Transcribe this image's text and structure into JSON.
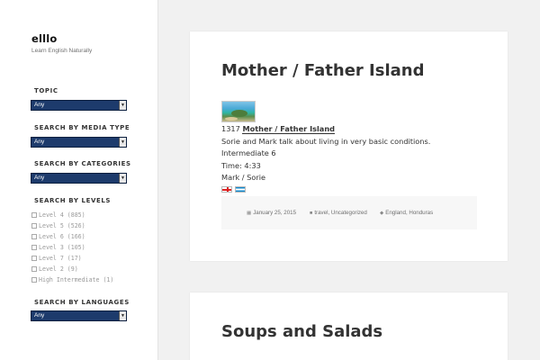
{
  "site": {
    "title": "elllo",
    "description": "Learn English Naturally"
  },
  "sidebar": {
    "topic": {
      "title": "TOPIC",
      "selected": "Any"
    },
    "media": {
      "title": "SEARCH BY MEDIA TYPE",
      "selected": "Any"
    },
    "categories": {
      "title": "SEARCH BY CATEGORIES",
      "selected": "Any"
    },
    "levels": {
      "title": "SEARCH BY LEVELS",
      "items": [
        {
          "label": "Level 4 (885)"
        },
        {
          "label": "Level 5 (526)"
        },
        {
          "label": "Level 6 (166)"
        },
        {
          "label": "Level 3 (105)"
        },
        {
          "label": "Level 7 (17)"
        },
        {
          "label": "Level 2 (9)"
        },
        {
          "label": "High Intermediate (1)"
        }
      ]
    },
    "languages": {
      "title": "SEARCH BY LANGUAGES",
      "selected": "Any"
    }
  },
  "posts": [
    {
      "title": "Mother / Father Island",
      "number": "1317",
      "link": "Mother / Father Island",
      "summary": "Sorie and Mark talk about living in very basic conditions.",
      "level": "Intermediate 6",
      "time": "Time: 4:33",
      "speakers": "Mark / Sorie",
      "meta": {
        "date": "January 25, 2015",
        "categories": "travel, Uncategorized",
        "tags": "England, Honduras"
      }
    },
    {
      "title": "Soups and Salads"
    }
  ]
}
